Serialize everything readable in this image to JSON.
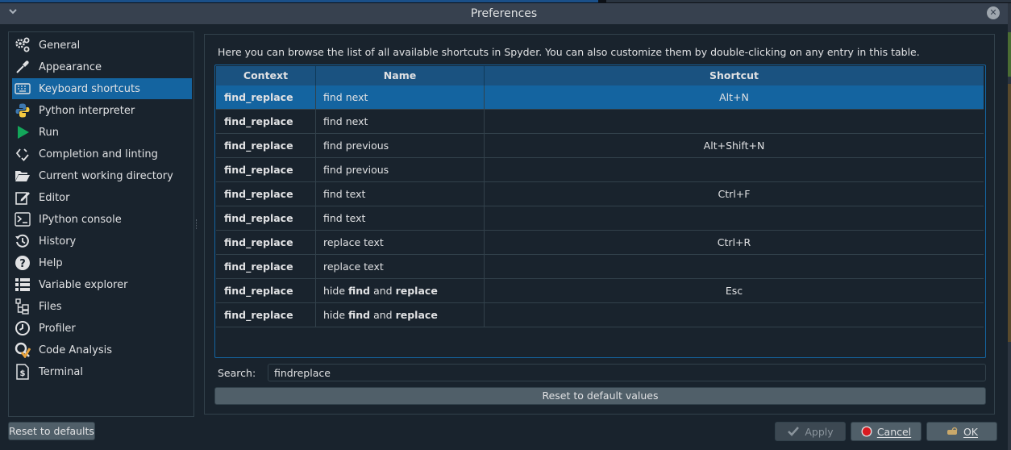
{
  "window": {
    "title": "Preferences"
  },
  "sidebar": {
    "items": [
      {
        "label": "General",
        "icon": "gears-icon"
      },
      {
        "label": "Appearance",
        "icon": "eyedropper-icon"
      },
      {
        "label": "Keyboard shortcuts",
        "icon": "keyboard-icon",
        "selected": true
      },
      {
        "label": "Python interpreter",
        "icon": "python-icon"
      },
      {
        "label": "Run",
        "icon": "play-icon"
      },
      {
        "label": "Completion and linting",
        "icon": "code-check-icon"
      },
      {
        "label": "Current working directory",
        "icon": "folder-open-icon"
      },
      {
        "label": "Editor",
        "icon": "edit-icon"
      },
      {
        "label": "IPython console",
        "icon": "terminal-icon"
      },
      {
        "label": "History",
        "icon": "history-icon"
      },
      {
        "label": "Help",
        "icon": "question-circle-icon"
      },
      {
        "label": "Variable explorer",
        "icon": "list-icon"
      },
      {
        "label": "Files",
        "icon": "file-tree-icon"
      },
      {
        "label": "Profiler",
        "icon": "clock-icon"
      },
      {
        "label": "Code Analysis",
        "icon": "code-analysis-icon"
      },
      {
        "label": "Terminal",
        "icon": "terminal-file-icon"
      }
    ]
  },
  "shortcuts": {
    "description": "Here you can browse the list of all available shortcuts in Spyder. You can also customize them by double-clicking on any entry in this table.",
    "columns": [
      "Context",
      "Name",
      "Shortcut"
    ],
    "rows": [
      {
        "context": "find_replace",
        "name": "find next",
        "shortcut": "Alt+N",
        "selected": true
      },
      {
        "context": "find_replace",
        "name": "find next",
        "shortcut": ""
      },
      {
        "context": "find_replace",
        "name": "find previous",
        "shortcut": "Alt+Shift+N"
      },
      {
        "context": "find_replace",
        "name": "find previous",
        "shortcut": ""
      },
      {
        "context": "find_replace",
        "name": "find text",
        "shortcut": "Ctrl+F"
      },
      {
        "context": "find_replace",
        "name": "find text",
        "shortcut": ""
      },
      {
        "context": "find_replace",
        "name": "replace text",
        "shortcut": "Ctrl+R"
      },
      {
        "context": "find_replace",
        "name": "replace text",
        "shortcut": ""
      },
      {
        "context": "find_replace",
        "name_parts": [
          "hide ",
          "find",
          " and ",
          "replace"
        ],
        "shortcut": "Esc"
      },
      {
        "context": "find_replace",
        "name_parts": [
          "hide ",
          "find",
          " and ",
          "replace"
        ],
        "shortcut": ""
      }
    ],
    "search_label": "Search:",
    "search_value": "findreplace",
    "reset_values_label": "Reset to default values"
  },
  "footer": {
    "reset_defaults_label": "Reset to defaults",
    "apply_label": "Apply",
    "cancel_label": "Cancel",
    "ok_label": "OK"
  },
  "colors": {
    "background": "#19232d",
    "selection": "#1464a0",
    "header": "#1a5280",
    "button": "#505f69"
  }
}
